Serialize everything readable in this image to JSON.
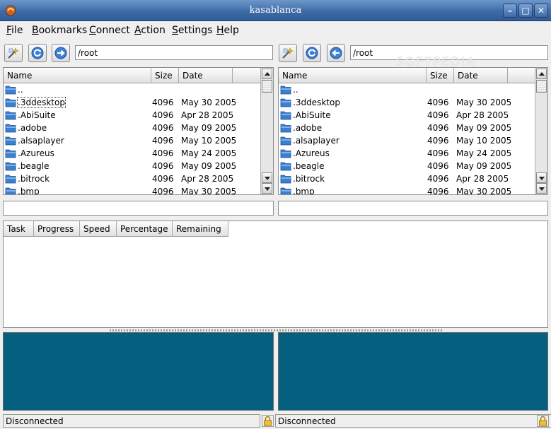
{
  "window": {
    "title": "kasablanca"
  },
  "menu": [
    {
      "label": "File",
      "accel": "F",
      "rest": "ile"
    },
    {
      "label": "Bookmarks",
      "accel": "B",
      "rest": "ookmarks"
    },
    {
      "label": "Connect",
      "accel": "C",
      "rest": "onnect"
    },
    {
      "label": "Action",
      "accel": "A",
      "rest": "ction"
    },
    {
      "label": "Settings",
      "accel": "S",
      "rest": "ettings"
    },
    {
      "label": "Help",
      "accel": "H",
      "rest": "elp"
    }
  ],
  "left": {
    "path": "/root",
    "columns": [
      "Name",
      "Size",
      "Date"
    ],
    "rows": [
      {
        "name": "..",
        "size": "",
        "date": ""
      },
      {
        "name": ".3ddesktop",
        "size": "4096",
        "date": "May 30 2005"
      },
      {
        "name": ".AbiSuite",
        "size": "4096",
        "date": "Apr 28 2005"
      },
      {
        "name": ".adobe",
        "size": "4096",
        "date": "May 09 2005"
      },
      {
        "name": ".alsaplayer",
        "size": "4096",
        "date": "May 10 2005"
      },
      {
        "name": ".Azureus",
        "size": "4096",
        "date": "May 24 2005"
      },
      {
        "name": ".beagle",
        "size": "4096",
        "date": "May 09 2005"
      },
      {
        "name": ".bitrock",
        "size": "4096",
        "date": "Apr 28 2005"
      },
      {
        "name": ".bmp",
        "size": "4096",
        "date": "May 30 2005"
      }
    ],
    "status": "Disconnected"
  },
  "right": {
    "path": "/root",
    "columns": [
      "Name",
      "Size",
      "Date"
    ],
    "rows": [
      {
        "name": "..",
        "size": "",
        "date": ""
      },
      {
        "name": ".3ddesktop",
        "size": "4096",
        "date": "May 30 2005"
      },
      {
        "name": ".AbiSuite",
        "size": "4096",
        "date": "Apr 28 2005"
      },
      {
        "name": ".adobe",
        "size": "4096",
        "date": "May 09 2005"
      },
      {
        "name": ".alsaplayer",
        "size": "4096",
        "date": "May 10 2005"
      },
      {
        "name": ".Azureus",
        "size": "4096",
        "date": "May 24 2005"
      },
      {
        "name": ".beagle",
        "size": "4096",
        "date": "May 09 2005"
      },
      {
        "name": ".bitrock",
        "size": "4096",
        "date": "Apr 28 2005"
      },
      {
        "name": ".bmp",
        "size": "4096",
        "date": "May 30 2005"
      }
    ],
    "status": "Disconnected"
  },
  "queue": {
    "columns": [
      "Task",
      "Progress",
      "Speed",
      "Percentage",
      "Remaining"
    ]
  },
  "watermark": "SOFTPEDIA",
  "colors": {
    "log_bg": "#05607f",
    "titlebar": "#3f6ca8",
    "folder": "#3a7fd0"
  }
}
